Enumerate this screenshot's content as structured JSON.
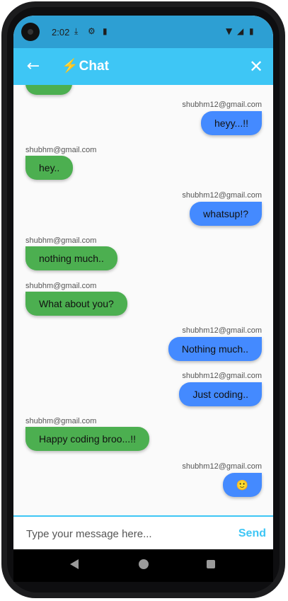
{
  "status_bar": {
    "time": "2:02",
    "icons": [
      "download-icon",
      "settings-icon",
      "sd-card-icon",
      "wifi-icon",
      "signal-icon",
      "battery-icon"
    ]
  },
  "app_bar": {
    "title_emoji": "⚡",
    "title": "Chat",
    "back_icon": "arrow-left-icon",
    "close_icon": "close-icon"
  },
  "messages": [
    {
      "sender": "shubhm12@gmail.com",
      "text": "heyy...!!",
      "direction": "out"
    },
    {
      "sender": "shubhm@gmail.com",
      "text": "hey..",
      "direction": "in"
    },
    {
      "sender": "shubhm12@gmail.com",
      "text": "whatsup!?",
      "direction": "out"
    },
    {
      "sender": "shubhm@gmail.com",
      "text": "nothing much..",
      "direction": "in"
    },
    {
      "sender": "shubhm@gmail.com",
      "text": "What about you?",
      "direction": "in"
    },
    {
      "sender": "shubhm12@gmail.com",
      "text": "Nothing much..",
      "direction": "out"
    },
    {
      "sender": "shubhm12@gmail.com",
      "text": "Just coding..",
      "direction": "out"
    },
    {
      "sender": "shubhm@gmail.com",
      "text": "Happy coding broo...!!",
      "direction": "in"
    },
    {
      "sender": "shubhm12@gmail.com",
      "text": "🙂",
      "direction": "out"
    }
  ],
  "composer": {
    "placeholder": "Type your message here...",
    "value": "",
    "send_label": "Send"
  },
  "colors": {
    "status_bar": "#2d9fd3",
    "app_bar": "#3ec6f5",
    "incoming_bubble": "#4caf50",
    "outgoing_bubble": "#448aff",
    "send": "#3ec6f5"
  },
  "nav_bar": {
    "icons": [
      "nav-back-icon",
      "nav-home-icon",
      "nav-recents-icon"
    ]
  }
}
